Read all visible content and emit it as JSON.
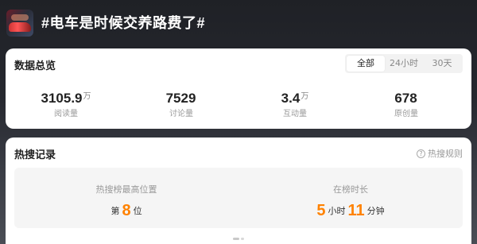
{
  "header": {
    "topic_title": "#电车是时候交养路费了#"
  },
  "overview": {
    "title": "数据总览",
    "tabs": [
      {
        "label": "全部",
        "active": true
      },
      {
        "label": "24小时",
        "active": false
      },
      {
        "label": "30天",
        "active": false
      }
    ],
    "stats": [
      {
        "value": "3105.9",
        "unit": "万",
        "label": "阅读量"
      },
      {
        "value": "7529",
        "unit": "",
        "label": "讨论量"
      },
      {
        "value": "3.4",
        "unit": "万",
        "label": "互动量"
      },
      {
        "value": "678",
        "unit": "",
        "label": "原创量"
      }
    ]
  },
  "hot_search": {
    "title": "热搜记录",
    "rules_label": "热搜规则",
    "rules_icon": "question-circle-icon",
    "highest_position": {
      "label": "热搜榜最高位置",
      "prefix": "第",
      "value": "8",
      "suffix": "位"
    },
    "duration": {
      "label": "在榜时长",
      "hours": "5",
      "hours_unit": "小时",
      "minutes": "11",
      "minutes_unit": "分钟"
    }
  },
  "colors": {
    "accent": "#ff8200",
    "background_dark": "#26282f",
    "card": "#ffffff",
    "panel": "#f5f5f5"
  }
}
